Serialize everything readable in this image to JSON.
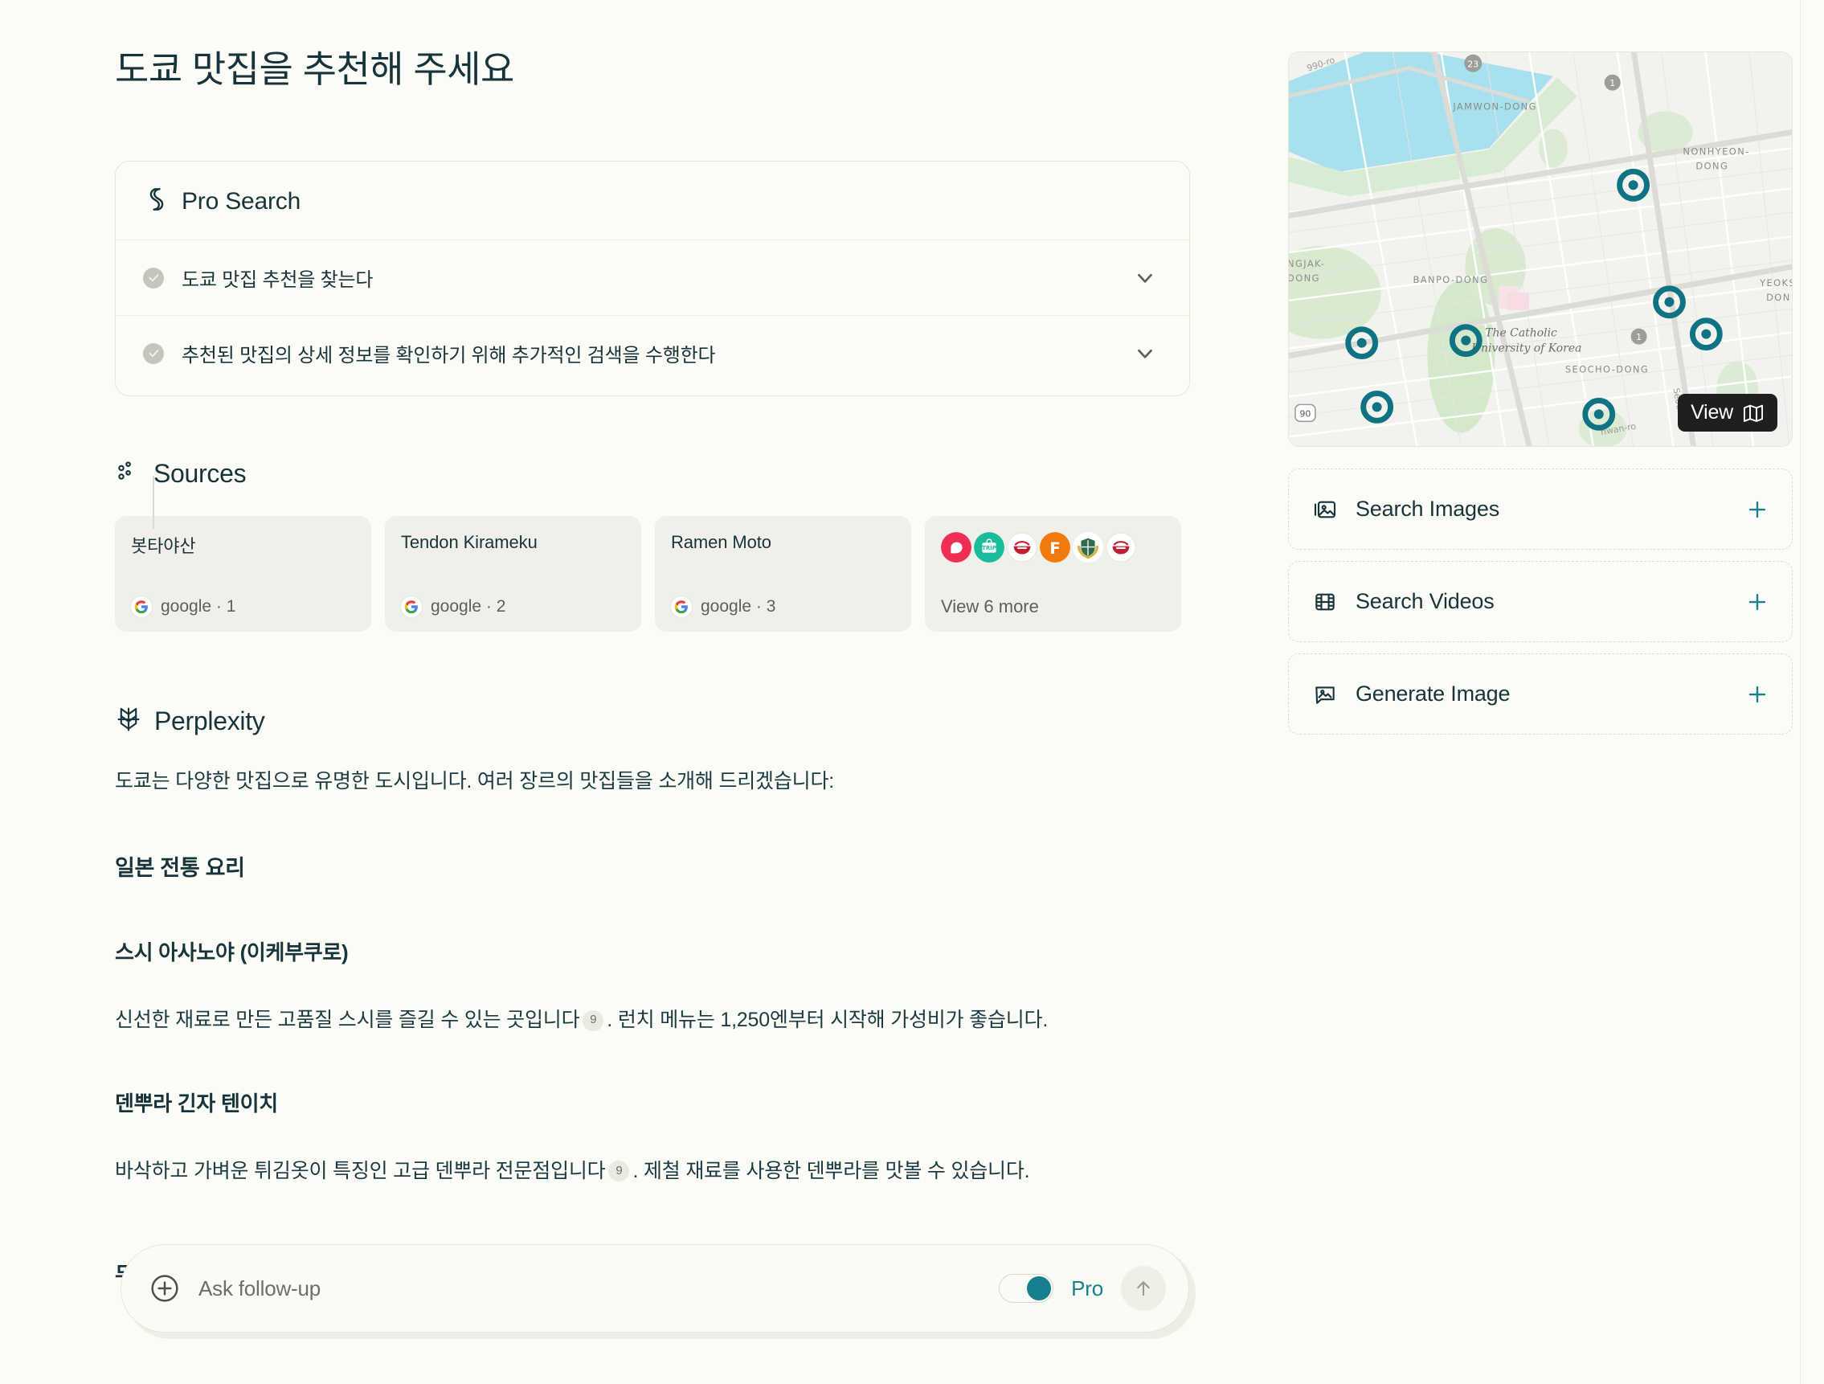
{
  "page": {
    "title": "도쿄 맛집을 추천해 주세요"
  },
  "pro_search": {
    "header": "Pro Search",
    "icon": "pro-search-spiral-icon",
    "steps": [
      {
        "label": "도쿄 맛집 추천을 찾는다",
        "state": "done",
        "chevron": "chevron-down-icon"
      },
      {
        "label": "추천된 맛집의 상세 정보를 확인하기 위해 추가적인 검색을 수행한다",
        "state": "done",
        "chevron": "chevron-down-icon"
      }
    ]
  },
  "sources": {
    "header": "Sources",
    "icon": "sources-dots-icon",
    "cards": [
      {
        "name": "봇타야산",
        "provider": "google · 1",
        "favicon": "google-icon"
      },
      {
        "name": "Tendon Kirameku",
        "provider": "google · 2",
        "favicon": "google-icon"
      },
      {
        "name": "Ramen Moto",
        "provider": "google · 3",
        "favicon": "google-icon"
      }
    ],
    "more_card": {
      "label": "View 6 more",
      "favicons": [
        {
          "name": "chat-bubble-favicon",
          "color": "#ef2e55"
        },
        {
          "name": "tripadvisor-trip-favicon",
          "color": "#1bbc9b",
          "text": "TRIP"
        },
        {
          "name": "ramen-bowl-favicon",
          "color": "#bf1e2e"
        },
        {
          "name": "foursquare-f-favicon",
          "color": "#f2790d",
          "text": "F"
        },
        {
          "name": "crest-favicon",
          "color": "#2f6b4f"
        },
        {
          "name": "ramen-bowl-favicon-2",
          "color": "#bf1e2e"
        }
      ]
    }
  },
  "answer": {
    "header": "Perplexity",
    "icon": "perplexity-logo-icon",
    "intro": "도쿄는 다양한 맛집으로 유명한 도시입니다. 여러 장르의 맛집들을 소개해 드리겠습니다:",
    "section_heading": "일본 전통 요리",
    "items": [
      {
        "heading": "스시 아사노야 (이케부쿠로)",
        "body_before": "신선한 재료로 만든 고품질 스시를 즐길 수 있는 곳입니다",
        "citation": "9",
        "body_after": ". 런치 메뉴는 1,250엔부터 시작해 가성비가 좋습니다."
      },
      {
        "heading": "덴뿌라 긴자 텐이치",
        "body_before": "바삭하고 가벼운 튀김옷이 특징인 고급 덴뿌라 전문점입니다",
        "citation": "9",
        "body_after": ". 제철 재료를 사용한 덴뿌라를 맛볼 수 있습니다."
      }
    ],
    "next_heading": "무테키야"
  },
  "composer": {
    "plus_icon": "plus-circle-icon",
    "placeholder": "Ask follow-up",
    "value": "",
    "toggle": {
      "label": "Pro",
      "on": true,
      "color": "#17808e"
    },
    "submit_icon": "arrow-up-icon"
  },
  "sidebar": {
    "map": {
      "view_button": "View",
      "view_icon": "map-icon",
      "labels": [
        "JAMWON-DONG",
        "NONHYEON-DONG",
        "BANPO-DONG",
        "DONGJAK-DONG",
        "SEOCHO-DONG",
        "YEOKSAM-DONG",
        "The Catholic University of Korea",
        "Seoun-ro",
        "hwan-ro",
        "990-ro"
      ],
      "route_shields": [
        "23",
        "1",
        "1",
        "90"
      ],
      "pin_count": 9,
      "pin_color": "#0f7384"
    },
    "actions": [
      {
        "label": "Search Images",
        "icon": "images-icon",
        "add_icon": "plus-icon"
      },
      {
        "label": "Search Videos",
        "icon": "video-film-icon",
        "add_icon": "plus-icon"
      },
      {
        "label": "Generate Image",
        "icon": "generate-image-icon",
        "add_icon": "plus-icon"
      }
    ],
    "accent": "#1b7f8e"
  }
}
